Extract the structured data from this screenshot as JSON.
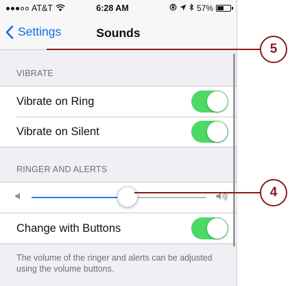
{
  "status_bar": {
    "carrier": "AT&T",
    "time": "6:28 AM",
    "battery_percent": "57%",
    "battery_level": 0.57
  },
  "nav": {
    "back_label": "Settings",
    "title": "Sounds"
  },
  "vibrate": {
    "header": "VIBRATE",
    "items": [
      {
        "label": "Vibrate on Ring",
        "on": true
      },
      {
        "label": "Vibrate on Silent",
        "on": true
      }
    ]
  },
  "ringer": {
    "header": "RINGER AND ALERTS",
    "volume_level": 0.55,
    "change_with_buttons": {
      "label": "Change with Buttons",
      "on": true
    },
    "note": "The volume of the ringer and alerts can be adjusted using the volume buttons."
  },
  "callouts": {
    "back": "5",
    "slider": "4"
  },
  "colors": {
    "accent": "#0a6fe8",
    "toggle_on": "#4cd964",
    "slider_fill": "#1f7cf0",
    "callout": "#8b1a1a"
  }
}
